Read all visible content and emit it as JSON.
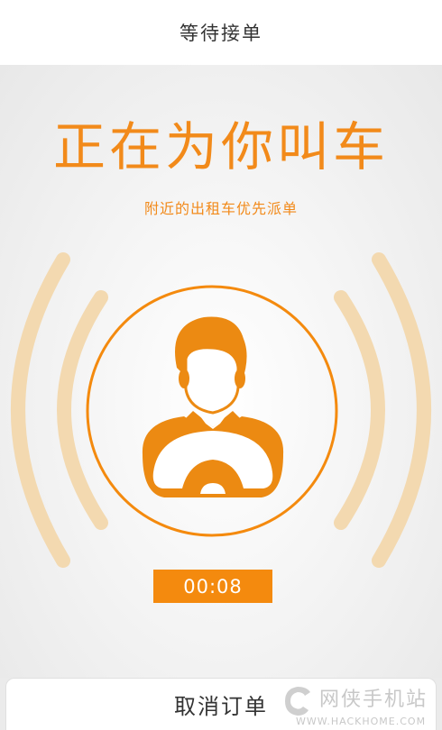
{
  "header": {
    "title": "等待接单"
  },
  "main": {
    "headline": "正在为你叫车",
    "subtitle": "附近的出租车优先派单",
    "illustration_icon": "driver-steering-wheel-icon",
    "signal_icon": "signal-waves-icon",
    "timer": "00:08"
  },
  "footer": {
    "cancel_label": "取消订单"
  },
  "watermark": {
    "name": "网侠手机站",
    "url": "WWW.HACKHOME.COM"
  },
  "colors": {
    "accent": "#f48a0e",
    "wave": "#f3d9b0",
    "background": "#ebebeb"
  }
}
